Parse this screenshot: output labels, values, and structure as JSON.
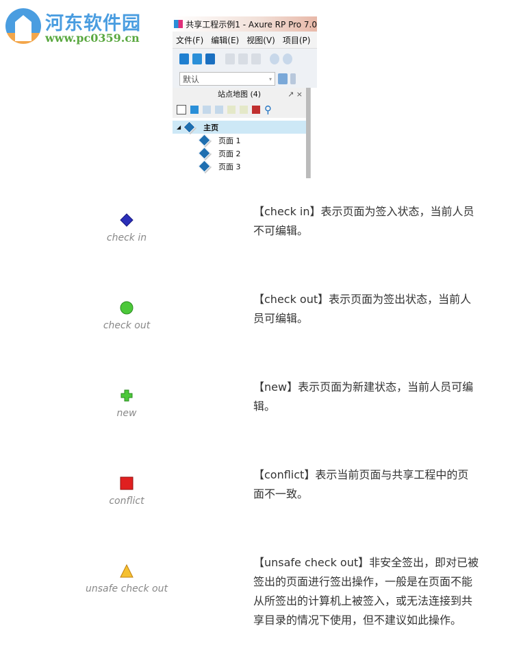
{
  "logo": {
    "name": "河东软件园",
    "url": "www.pc0359.cn"
  },
  "app": {
    "title": "共享工程示例1 - Axure RP Pro 7.0",
    "menu": [
      "文件(F)",
      "编辑(E)",
      "视图(V)",
      "项目(P)"
    ],
    "style_select": "默认",
    "sitemap": {
      "title": "站点地图 (4)",
      "root": "主页",
      "pages": [
        "页面 1",
        "页面 2",
        "页面 3"
      ]
    }
  },
  "legend": [
    {
      "icon": "blue-diamond-icon",
      "label": "check in",
      "desc": "【check in】表示页面为签入状态，当前人员不可编辑。"
    },
    {
      "icon": "green-circle-icon",
      "label": "check out",
      "desc": "【check out】表示页面为签出状态，当前人员可编辑。"
    },
    {
      "icon": "green-plus-icon",
      "label": "new",
      "desc": "【new】表示页面为新建状态，当前人员可编辑。"
    },
    {
      "icon": "red-square-icon",
      "label": "conflict",
      "desc": "【conflict】表示当前页面与共享工程中的页面不一致。"
    },
    {
      "icon": "yellow-triangle-icon",
      "label": "unsafe check out",
      "desc": "【unsafe check out】非安全签出，即对已被签出的页面进行签出操作，一般是在页面不能从所签出的计算机上被签入，或无法连接到共享目录的情况下使用，但不建议如此操作。"
    }
  ]
}
